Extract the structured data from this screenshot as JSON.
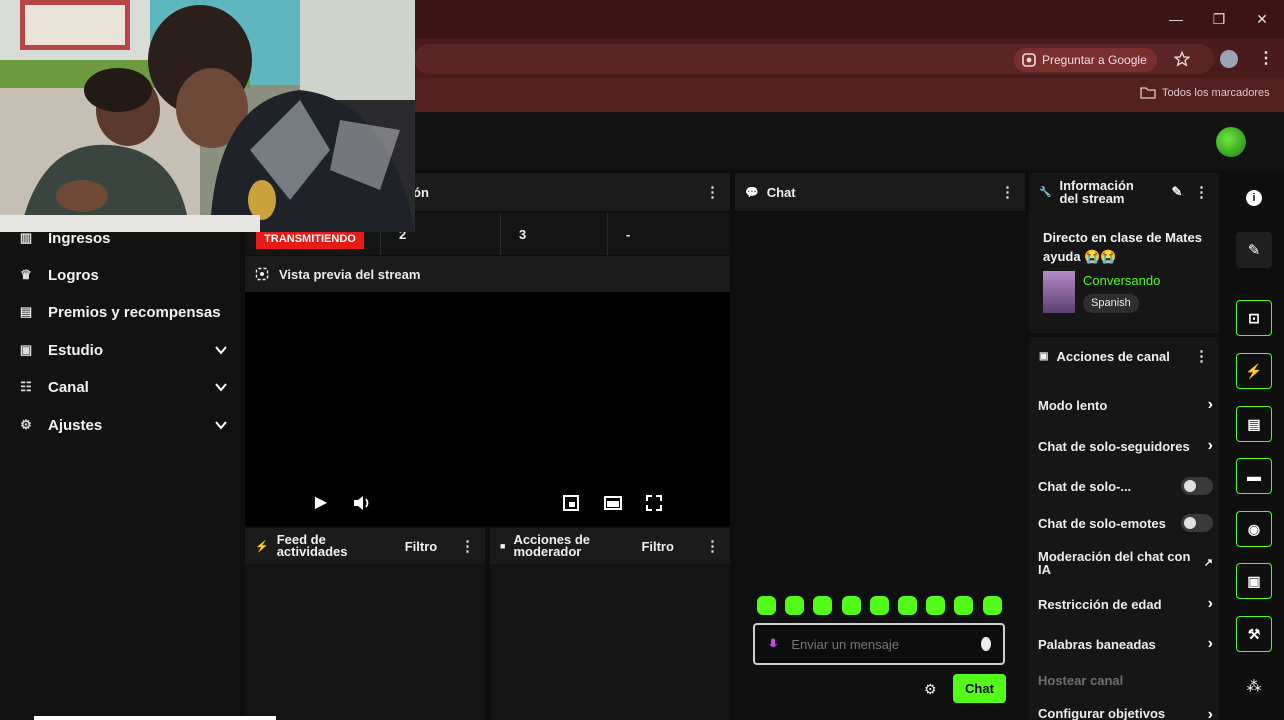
{
  "browser": {
    "ask_google": "Preguntar a Google",
    "all_bookmarks": "Todos los marcadores",
    "window_controls": {
      "minimize": "—",
      "maximize": "❐",
      "close": "✕"
    }
  },
  "sidebar": {
    "items": [
      {
        "label": "Ingresos",
        "icon": "chart-icon",
        "expandable": false
      },
      {
        "label": "Logros",
        "icon": "trophy-icon",
        "expandable": false
      },
      {
        "label": "Premios y recompensas",
        "icon": "gift-icon",
        "expandable": false
      },
      {
        "label": "Estudio",
        "icon": "studio-icon",
        "expandable": true
      },
      {
        "label": "Canal",
        "icon": "users-icon",
        "expandable": true
      },
      {
        "label": "Ajustes",
        "icon": "gear-icon",
        "expandable": true
      }
    ]
  },
  "stream_panel": {
    "title_fragment": "ón",
    "live_badge": "TRANSMITIENDO",
    "stats": [
      "2",
      "3",
      "-"
    ]
  },
  "preview": {
    "title": "Vista previa del stream"
  },
  "activity_feed": {
    "title": "Feed de actividades",
    "filter": "Filtro"
  },
  "mod_actions": {
    "title": "Acciones de moderador",
    "filter": "Filtro"
  },
  "chat": {
    "title": "Chat",
    "placeholder": "Enviar un mensaje",
    "send_label": "Chat",
    "emote_count": 9,
    "accent": "#53fc18"
  },
  "stream_info": {
    "title": "Información del stream",
    "stream_title": "Directo en clase de Mates ayuda 😭😭",
    "category": "Conversando",
    "language_tag": "Spanish"
  },
  "channel_actions": {
    "title": "Acciones de canal",
    "items": [
      {
        "label": "Modo lento",
        "control": "chevron"
      },
      {
        "label": "Chat de solo-seguidores",
        "control": "chevron"
      },
      {
        "label": "Chat de solo-...",
        "control": "toggle"
      },
      {
        "label": "Chat de solo-emotes",
        "control": "toggle"
      },
      {
        "label": "Moderación del chat con IA",
        "control": "external"
      },
      {
        "label": "Restricción de edad",
        "control": "chevron"
      },
      {
        "label": "Palabras baneadas",
        "control": "chevron"
      },
      {
        "label": "Hostear canal",
        "control": "none"
      },
      {
        "label": "Configurar objetivos",
        "control": "chevron"
      }
    ]
  }
}
